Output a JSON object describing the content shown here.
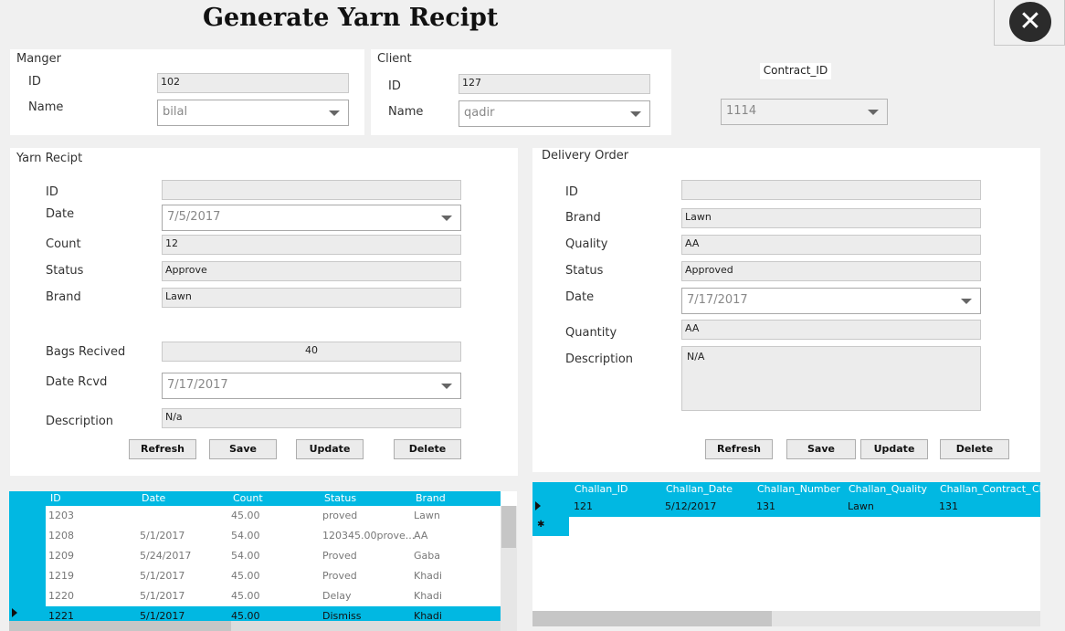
{
  "window": {
    "title": "Generate Yarn Recipt",
    "close_icon": "close-icon"
  },
  "manager": {
    "title": "Manger",
    "id_label": "ID",
    "id_value": "102",
    "name_label": "Name",
    "name_value": "bilal"
  },
  "client": {
    "title": "Client",
    "id_label": "ID",
    "id_value": "127",
    "name_label": "Name",
    "name_value": "qadir"
  },
  "contract": {
    "label": "Contract_ID",
    "value": "1114"
  },
  "yarn": {
    "title": "Yarn Recipt",
    "id_label": "ID",
    "id_value": "",
    "date_label": "Date",
    "date_value": "7/5/2017",
    "count_label": "Count",
    "count_value": "12",
    "status_label": "Status",
    "status_value": "Approve",
    "brand_label": "Brand",
    "brand_value": "Lawn",
    "bags_label": "Bags Recived",
    "bags_value": "40",
    "daterc_label": "Date Rcvd",
    "daterc_value": "7/17/2017",
    "desc_label": "Description",
    "desc_value": "N/a",
    "buttons": {
      "refresh": "Refresh",
      "save": "Save",
      "update": "Update",
      "delete": "Delete"
    }
  },
  "delivery": {
    "title": "Delivery Order",
    "id_label": "ID",
    "id_value": "",
    "brand_label": "Brand",
    "brand_value": "Lawn",
    "quality_label": "Quality",
    "quality_value": "AA",
    "status_label": "Status",
    "status_value": "Approved",
    "date_label": "Date",
    "date_value": "7/17/2017",
    "quantity_label": "Quantity",
    "quantity_value": "AA",
    "desc_label": "Description",
    "desc_value": "N/A",
    "buttons": {
      "refresh": "Refresh",
      "save": "Save",
      "update": "Update",
      "delete": "Delete"
    }
  },
  "yarn_grid": {
    "columns": [
      "ID",
      "Date",
      "Count",
      "Status",
      "Brand"
    ],
    "rows": [
      [
        "1203",
        "",
        "45.00",
        "proved",
        "Lawn"
      ],
      [
        "1208",
        "5/1/2017",
        "54.00",
        "120345.00prove...",
        "AA"
      ],
      [
        "1209",
        "5/24/2017",
        "54.00",
        "Proved",
        "Gaba"
      ],
      [
        "1219",
        "5/1/2017",
        "45.00",
        "Proved",
        "Khadi"
      ],
      [
        "1220",
        "5/1/2017",
        "45.00",
        "Delay",
        "Khadi"
      ],
      [
        "1221",
        "5/1/2017",
        "45.00",
        "Dismiss",
        "Khadi"
      ]
    ]
  },
  "challan_grid": {
    "columns": [
      "Challan_ID",
      "Challan_Date",
      "Challan_Number",
      "Challan_Quality",
      "Challan_Contract_",
      "Ch"
    ],
    "rows": [
      [
        "121",
        "5/12/2017",
        "131",
        "Lawn",
        "131"
      ]
    ],
    "new_row_icon": "new-row-icon"
  }
}
